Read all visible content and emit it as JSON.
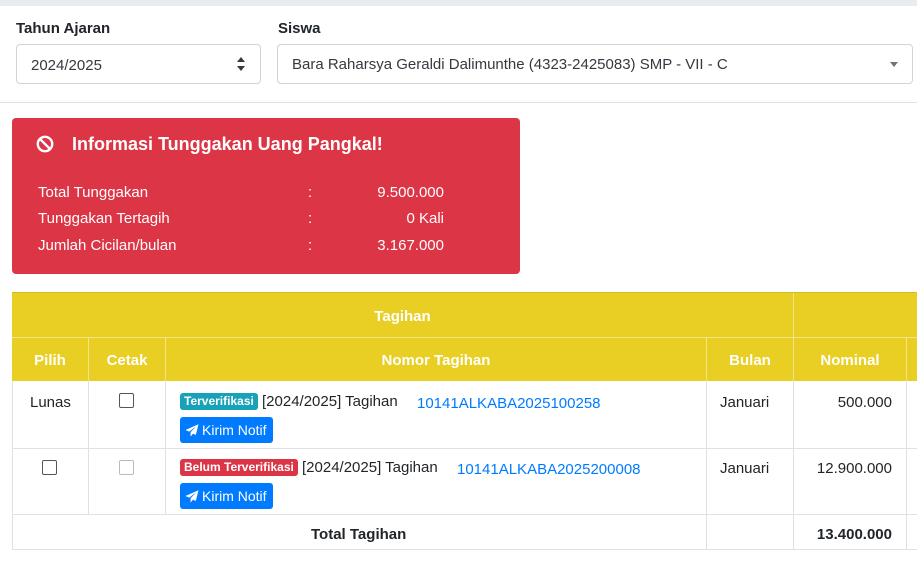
{
  "filters": {
    "tahun_label": "Tahun Ajaran",
    "tahun_value": "2024/2025",
    "siswa_label": "Siswa",
    "siswa_value": "Bara Raharsya Geraldi Dalimunthe (4323-2425083) SMP - VII - C"
  },
  "alert": {
    "title": "Informasi Tunggakan Uang Pangkal!",
    "rows": [
      {
        "key": "Total Tunggakan",
        "colon": ":",
        "value": "9.500.000"
      },
      {
        "key": "Tunggakan Tertagih",
        "colon": ":",
        "value": "0 Kali"
      },
      {
        "key": "Jumlah Cicilan/bulan",
        "colon": ":",
        "value": "3.167.000"
      }
    ],
    "color": "#dc3545"
  },
  "table": {
    "group_header": "Tagihan",
    "headers": {
      "pilih": "Pilih",
      "cetak": "Cetak",
      "nomor": "Nomor Tagihan",
      "bulan": "Bulan",
      "nominal": "Nominal"
    },
    "header_color": "#e9cf23",
    "rows": [
      {
        "pilih": "Lunas",
        "badge": "Terverifikasi",
        "desc": "[2024/2025] Tagihan",
        "nomor": "10141ALKABA2025100258",
        "button": "Kirim Notif",
        "bulan": "Januari",
        "nominal": "500.000"
      },
      {
        "pilih": "",
        "badge": "Belum Terverifikasi",
        "desc": "[2024/2025] Tagihan",
        "nomor": "10141ALKABA2025200008",
        "button": "Kirim Notif",
        "bulan": "Januari",
        "nominal": "12.900.000"
      }
    ],
    "total_label": "Total Tagihan",
    "total_value": "13.400.000"
  },
  "icons": {
    "ban": "ban-icon",
    "send": "paper-plane-icon",
    "updown": "sort-updown-icon",
    "caret": "caret-down-icon"
  }
}
